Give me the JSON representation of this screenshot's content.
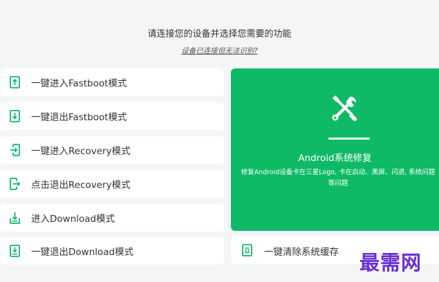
{
  "header": {
    "title": "请连接您的设备并选择您需要的功能",
    "help_link": "设备已连接但无法识别?"
  },
  "menu": [
    {
      "label": "一键进入Fastboot模式",
      "icon": "phone-arrow-up-icon"
    },
    {
      "label": "一键退出Fastboot模式",
      "icon": "phone-arrow-down-icon"
    },
    {
      "label": "一键进入Recovery模式",
      "icon": "phone-enter-icon"
    },
    {
      "label": "点击退出Recovery模式",
      "icon": "phone-exit-icon"
    },
    {
      "label": "进入Download模式",
      "icon": "download-tray-icon"
    },
    {
      "label": "一键退出Download模式",
      "icon": "phone-exit-download-icon"
    }
  ],
  "feature": {
    "title": "Android系统修复",
    "description": "修复Android设备卡在三星Logo, 卡在启动、黑屏、闪退, 系统问题等问题",
    "icon": "wrench-screwdriver-icon"
  },
  "cache": {
    "label": "一键清除系统缓存",
    "icon": "trash-phone-icon"
  },
  "watermark": "最需网",
  "colors": {
    "accent": "#0fba66",
    "background": "#f4f5f7",
    "watermark": "#6a2fd6"
  }
}
